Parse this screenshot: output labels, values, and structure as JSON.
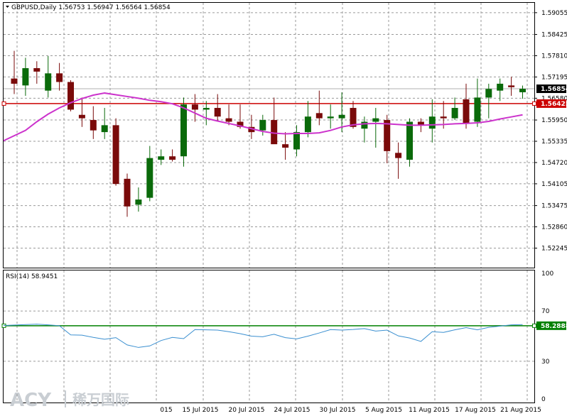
{
  "header": {
    "symbol_line": "GBPUSD,Daily  1.56753 1.56947 1.56564 1.56854",
    "rsi_label": "RSI(14) 58.9451"
  },
  "watermark": {
    "brand": "ACY",
    "brand_cn": "稀万国际"
  },
  "colors": {
    "bull": "#0a6a0a",
    "bear": "#7a0a0a",
    "ma": "#cc33cc",
    "rsi": "#3a8fd0",
    "support": "#cc0000",
    "rsi_level": "#008000",
    "grid": "#9a9a9a",
    "tag_current": "#000000",
    "tag_support": "#cc0000",
    "tag_rsi": "#008000"
  },
  "chart_data": [
    {
      "type": "candlestick",
      "symbol": "GBPUSD",
      "timeframe": "Daily",
      "ylim": [
        1.5168,
        1.5936
      ],
      "y_ticks": [
        "1.59055",
        "1.58425",
        "1.57810",
        "1.57195",
        "1.56580",
        "1.55950",
        "1.55335",
        "1.54720",
        "1.54105",
        "1.53475",
        "1.52860",
        "1.52245"
      ],
      "x_tick_labels": [
        "015",
        "15 Jul 2015",
        "20 Jul 2015",
        "24 Jul 2015",
        "30 Jul 2015",
        "5 Aug 2015",
        "11 Aug 2015",
        "17 Aug 2015",
        "21 Aug 2015"
      ],
      "current_price": {
        "value": 1.56854,
        "label": "1.56854"
      },
      "support_line": {
        "value": 1.56425,
        "label": "1.56425"
      },
      "candles": [
        {
          "o": 1.5715,
          "h": 1.5795,
          "l": 1.567,
          "c": 1.57
        },
        {
          "o": 1.5695,
          "h": 1.5775,
          "l": 1.5665,
          "c": 1.5745
        },
        {
          "o": 1.5745,
          "h": 1.5765,
          "l": 1.57,
          "c": 1.5735
        },
        {
          "o": 1.568,
          "h": 1.578,
          "l": 1.566,
          "c": 1.573
        },
        {
          "o": 1.573,
          "h": 1.576,
          "l": 1.568,
          "c": 1.5705
        },
        {
          "o": 1.5705,
          "h": 1.571,
          "l": 1.562,
          "c": 1.5625
        },
        {
          "o": 1.561,
          "h": 1.566,
          "l": 1.5575,
          "c": 1.56
        },
        {
          "o": 1.5595,
          "h": 1.5635,
          "l": 1.554,
          "c": 1.5565
        },
        {
          "o": 1.556,
          "h": 1.563,
          "l": 1.554,
          "c": 1.558
        },
        {
          "o": 1.558,
          "h": 1.56,
          "l": 1.5405,
          "c": 1.541
        },
        {
          "o": 1.5425,
          "h": 1.544,
          "l": 1.5315,
          "c": 1.5345
        },
        {
          "o": 1.535,
          "h": 1.54,
          "l": 1.533,
          "c": 1.5365
        },
        {
          "o": 1.537,
          "h": 1.552,
          "l": 1.536,
          "c": 1.5485
        },
        {
          "o": 1.548,
          "h": 1.551,
          "l": 1.5465,
          "c": 1.549
        },
        {
          "o": 1.549,
          "h": 1.551,
          "l": 1.5475,
          "c": 1.548
        },
        {
          "o": 1.549,
          "h": 1.566,
          "l": 1.546,
          "c": 1.564
        },
        {
          "o": 1.564,
          "h": 1.567,
          "l": 1.559,
          "c": 1.5625
        },
        {
          "o": 1.5625,
          "h": 1.565,
          "l": 1.558,
          "c": 1.563
        },
        {
          "o": 1.563,
          "h": 1.567,
          "l": 1.559,
          "c": 1.5605
        },
        {
          "o": 1.56,
          "h": 1.564,
          "l": 1.558,
          "c": 1.559
        },
        {
          "o": 1.559,
          "h": 1.564,
          "l": 1.557,
          "c": 1.5575
        },
        {
          "o": 1.5575,
          "h": 1.561,
          "l": 1.554,
          "c": 1.556
        },
        {
          "o": 1.5565,
          "h": 1.561,
          "l": 1.555,
          "c": 1.5595
        },
        {
          "o": 1.5595,
          "h": 1.566,
          "l": 1.553,
          "c": 1.5525
        },
        {
          "o": 1.5525,
          "h": 1.556,
          "l": 1.548,
          "c": 1.5515
        },
        {
          "o": 1.551,
          "h": 1.558,
          "l": 1.549,
          "c": 1.556
        },
        {
          "o": 1.556,
          "h": 1.565,
          "l": 1.5545,
          "c": 1.5605
        },
        {
          "o": 1.5615,
          "h": 1.568,
          "l": 1.558,
          "c": 1.56
        },
        {
          "o": 1.56,
          "h": 1.564,
          "l": 1.557,
          "c": 1.5605
        },
        {
          "o": 1.56,
          "h": 1.5675,
          "l": 1.556,
          "c": 1.561
        },
        {
          "o": 1.563,
          "h": 1.565,
          "l": 1.557,
          "c": 1.5575
        },
        {
          "o": 1.557,
          "h": 1.5605,
          "l": 1.553,
          "c": 1.559
        },
        {
          "o": 1.559,
          "h": 1.563,
          "l": 1.5515,
          "c": 1.56
        },
        {
          "o": 1.5595,
          "h": 1.561,
          "l": 1.547,
          "c": 1.5505
        },
        {
          "o": 1.55,
          "h": 1.553,
          "l": 1.5425,
          "c": 1.5485
        },
        {
          "o": 1.548,
          "h": 1.56,
          "l": 1.546,
          "c": 1.559
        },
        {
          "o": 1.559,
          "h": 1.56,
          "l": 1.556,
          "c": 1.558
        },
        {
          "o": 1.557,
          "h": 1.5655,
          "l": 1.553,
          "c": 1.5605
        },
        {
          "o": 1.5605,
          "h": 1.565,
          "l": 1.557,
          "c": 1.56
        },
        {
          "o": 1.56,
          "h": 1.566,
          "l": 1.5595,
          "c": 1.563
        },
        {
          "o": 1.5655,
          "h": 1.57,
          "l": 1.557,
          "c": 1.5585
        },
        {
          "o": 1.559,
          "h": 1.5715,
          "l": 1.5575,
          "c": 1.566
        },
        {
          "o": 1.566,
          "h": 1.57,
          "l": 1.56,
          "c": 1.5685
        },
        {
          "o": 1.568,
          "h": 1.5715,
          "l": 1.565,
          "c": 1.57
        },
        {
          "o": 1.5695,
          "h": 1.572,
          "l": 1.5665,
          "c": 1.569
        },
        {
          "o": 1.56753,
          "h": 1.56947,
          "l": 1.56564,
          "c": 1.56854
        }
      ],
      "ma_values": [
        1.5535,
        1.5565,
        1.559,
        1.5612,
        1.563,
        1.5645,
        1.5657,
        1.5667,
        1.5673,
        1.5668,
        1.5663,
        1.5658,
        1.5652,
        1.5648,
        1.5642,
        1.563,
        1.5615,
        1.56,
        1.5592,
        1.5585,
        1.5578,
        1.557,
        1.5562,
        1.5557,
        1.5555,
        1.5556,
        1.5556,
        1.5558,
        1.5565,
        1.5575,
        1.5581,
        1.5584,
        1.5585,
        1.5584,
        1.5582,
        1.558,
        1.558,
        1.5581,
        1.5582,
        1.5584,
        1.5585,
        1.5587,
        1.5591,
        1.5598,
        1.5604,
        1.561
      ]
    },
    {
      "type": "line",
      "name": "RSI(14) 58.9451",
      "ylim": [
        0,
        100
      ],
      "y_ticks": [
        "100",
        "70",
        "30",
        "0"
      ],
      "level_line": {
        "value": 58.2888,
        "label": "58.2888"
      },
      "values": [
        58.5,
        59.2,
        59.5,
        59.0,
        58.3,
        51.0,
        50.8,
        49.0,
        47.5,
        48.8,
        43.0,
        41.0,
        42.2,
        46.5,
        49.0,
        48.0,
        55.2,
        55.0,
        54.8,
        53.5,
        52.0,
        50.0,
        49.5,
        51.5,
        48.8,
        47.8,
        50.0,
        52.5,
        55.2,
        54.8,
        55.3,
        56.0,
        54.0,
        54.8,
        50.2,
        48.5,
        45.8,
        53.5,
        53.0,
        55.0,
        56.8,
        55.0,
        57.0,
        58.0,
        59.0,
        59.2
      ]
    }
  ]
}
